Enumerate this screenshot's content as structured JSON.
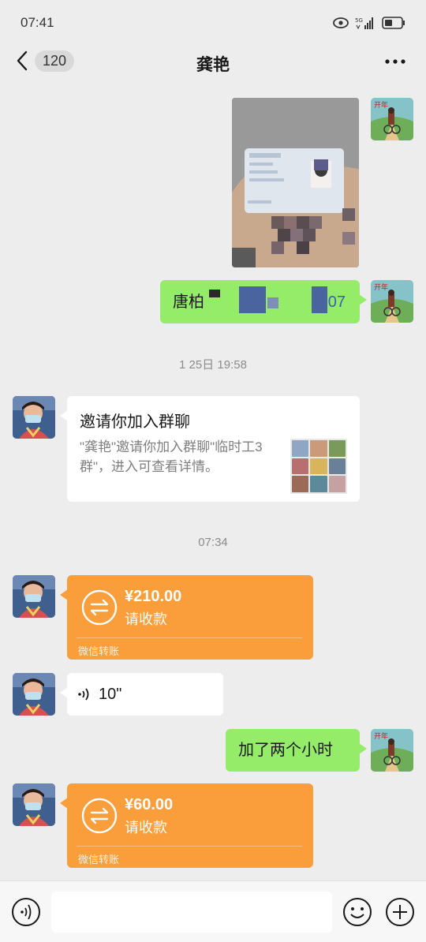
{
  "status_bar": {
    "time": "07:41",
    "network": "5G"
  },
  "header": {
    "unread_count": "120",
    "title": "龚艳"
  },
  "messages": {
    "text_1": "唐柏",
    "text_1_tail": "07",
    "timestamp_1": "1 25日 19:58",
    "invite": {
      "title": "邀请你加入群聊",
      "description": "\"龚艳\"邀请你加入群聊\"临时工3群\"，进入可查看详情。"
    },
    "timestamp_2": "07:34",
    "transfer_1": {
      "amount": "¥210.00",
      "status": "请收款",
      "footer": "微信转账"
    },
    "voice": {
      "duration": "10\""
    },
    "text_2": "加了两个小时",
    "transfer_2": {
      "amount": "¥60.00",
      "status": "请收款",
      "footer": "微信转账"
    }
  },
  "colors": {
    "green_bubble": "#95ec69",
    "transfer_orange": "#fa9d3b",
    "background": "#ededed"
  }
}
